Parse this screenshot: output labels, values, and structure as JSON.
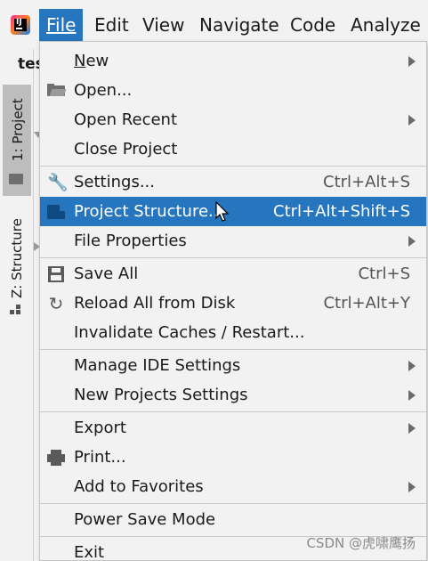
{
  "menubar": {
    "items": [
      {
        "label": "File",
        "active": true
      },
      {
        "label": "Edit"
      },
      {
        "label": "View"
      },
      {
        "label": "Navigate"
      },
      {
        "label": "Code"
      },
      {
        "label": "Analyze"
      }
    ]
  },
  "toolstrip": {
    "project_name": "tes",
    "project_tab": "1: Project",
    "structure_tab": "Z: Structure"
  },
  "file_menu": {
    "items": [
      {
        "label": "New",
        "submenu": true
      },
      {
        "label": "Open...",
        "icon": "folder-open-icon"
      },
      {
        "label": "Open Recent",
        "submenu": true
      },
      {
        "label": "Close Project"
      },
      {
        "label": "Settings...",
        "shortcut": "Ctrl+Alt+S",
        "icon": "wrench-icon"
      },
      {
        "label": "Project Structure...",
        "shortcut": "Ctrl+Alt+Shift+S",
        "icon": "project-structure-icon",
        "selected": true
      },
      {
        "label": "File Properties",
        "submenu": true
      },
      {
        "label": "Save All",
        "shortcut": "Ctrl+S",
        "icon": "save-icon"
      },
      {
        "label": "Reload All from Disk",
        "shortcut": "Ctrl+Alt+Y",
        "icon": "reload-icon"
      },
      {
        "label": "Invalidate Caches / Restart..."
      },
      {
        "label": "Manage IDE Settings",
        "submenu": true
      },
      {
        "label": "New Projects Settings",
        "submenu": true
      },
      {
        "label": "Export",
        "submenu": true
      },
      {
        "label": "Print...",
        "icon": "printer-icon"
      },
      {
        "label": "Add to Favorites",
        "submenu": true
      },
      {
        "label": "Power Save Mode"
      },
      {
        "label": "Exit"
      }
    ]
  },
  "watermark": "CSDN @虎啸鹰扬",
  "colors": {
    "selection": "#2675bf",
    "background": "#f2f2f2"
  }
}
